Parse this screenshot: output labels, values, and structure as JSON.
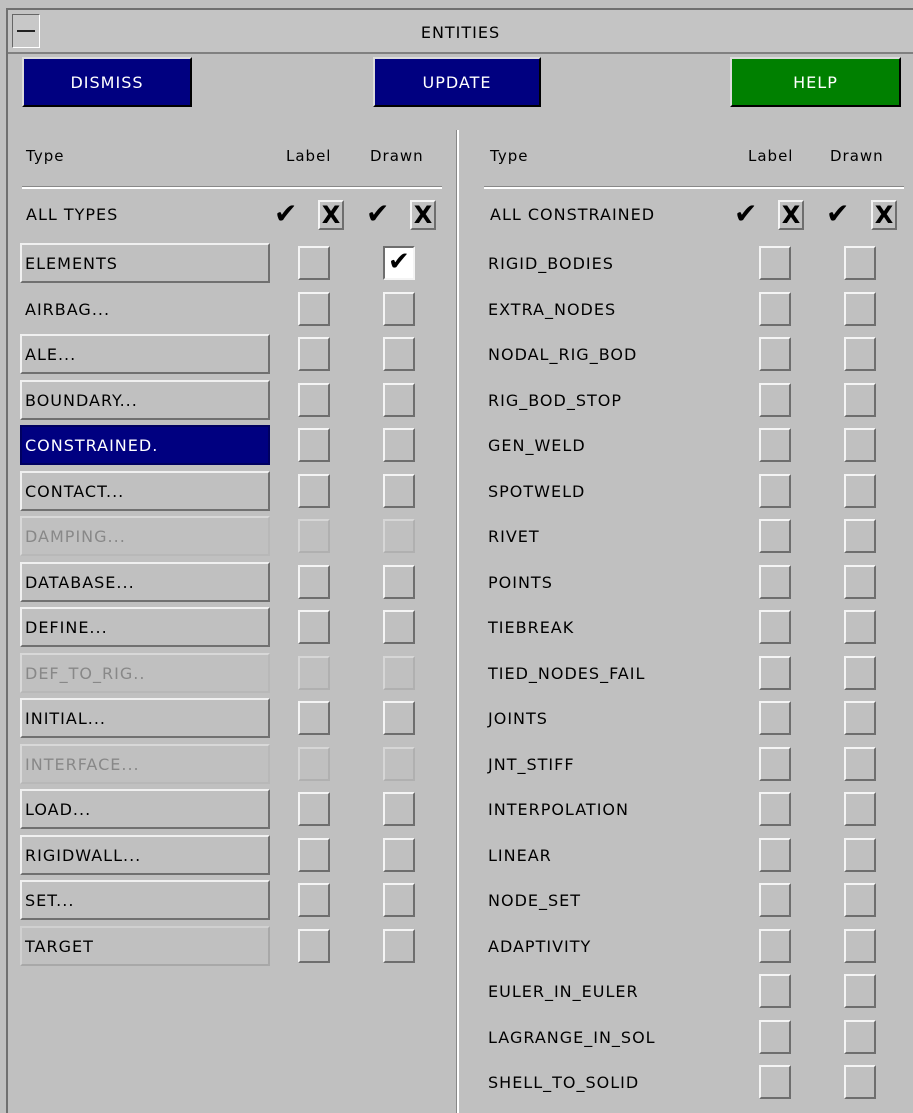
{
  "window": {
    "title": "ENTITIES"
  },
  "toolbar": {
    "dismiss": "DISMISS",
    "update": "UPDATE",
    "help": "HELP"
  },
  "left": {
    "headers": {
      "type": "Type",
      "label": "Label",
      "drawn": "Drawn"
    },
    "all_row": {
      "label": "ALL TYPES",
      "check": "✔",
      "cross": "X"
    },
    "items": [
      {
        "label": "ELEMENTS",
        "style": "button",
        "label_checked": false,
        "drawn_checked": true
      },
      {
        "label": "AIRBAG...",
        "style": "plain",
        "label_checked": false,
        "drawn_checked": false
      },
      {
        "label": "ALE...",
        "style": "button",
        "label_checked": false,
        "drawn_checked": false
      },
      {
        "label": "BOUNDARY...",
        "style": "button",
        "label_checked": false,
        "drawn_checked": false
      },
      {
        "label": "CONSTRAINED.",
        "style": "active",
        "label_checked": false,
        "drawn_checked": false
      },
      {
        "label": "CONTACT...",
        "style": "button",
        "label_checked": false,
        "drawn_checked": false
      },
      {
        "label": "DAMPING...",
        "style": "disabled",
        "label_checked": false,
        "drawn_checked": false
      },
      {
        "label": "DATABASE...",
        "style": "button",
        "label_checked": false,
        "drawn_checked": false
      },
      {
        "label": "DEFINE...",
        "style": "button",
        "label_checked": false,
        "drawn_checked": false
      },
      {
        "label": "DEF_TO_RIG..",
        "style": "disabled",
        "label_checked": false,
        "drawn_checked": false
      },
      {
        "label": "INITIAL...",
        "style": "button",
        "label_checked": false,
        "drawn_checked": false
      },
      {
        "label": "INTERFACE...",
        "style": "disabled",
        "label_checked": false,
        "drawn_checked": false
      },
      {
        "label": "LOAD...",
        "style": "button",
        "label_checked": false,
        "drawn_checked": false
      },
      {
        "label": "RIGIDWALL...",
        "style": "button",
        "label_checked": false,
        "drawn_checked": false
      },
      {
        "label": "SET...",
        "style": "button",
        "label_checked": false,
        "drawn_checked": false
      },
      {
        "label": "TARGET",
        "style": "flat",
        "label_checked": false,
        "drawn_checked": false
      }
    ]
  },
  "right": {
    "headers": {
      "type": "Type",
      "label": "Label",
      "drawn": "Drawn"
    },
    "all_row": {
      "label": "ALL CONSTRAINED",
      "check": "✔",
      "cross": "X"
    },
    "items": [
      {
        "label": "RIGID_BODIES"
      },
      {
        "label": "EXTRA_NODES"
      },
      {
        "label": "NODAL_RIG_BOD"
      },
      {
        "label": "RIG_BOD_STOP"
      },
      {
        "label": "GEN_WELD"
      },
      {
        "label": "SPOTWELD"
      },
      {
        "label": "RIVET"
      },
      {
        "label": "POINTS"
      },
      {
        "label": "TIEBREAK"
      },
      {
        "label": "TIED_NODES_FAIL"
      },
      {
        "label": "JOINTS"
      },
      {
        "label": "JNT_STIFF"
      },
      {
        "label": "INTERPOLATION"
      },
      {
        "label": "LINEAR"
      },
      {
        "label": "NODE_SET"
      },
      {
        "label": "ADAPTIVITY"
      },
      {
        "label": "EULER_IN_EULER"
      },
      {
        "label": "LAGRANGE_IN_SOL"
      },
      {
        "label": "SHELL_TO_SOLID"
      }
    ]
  }
}
